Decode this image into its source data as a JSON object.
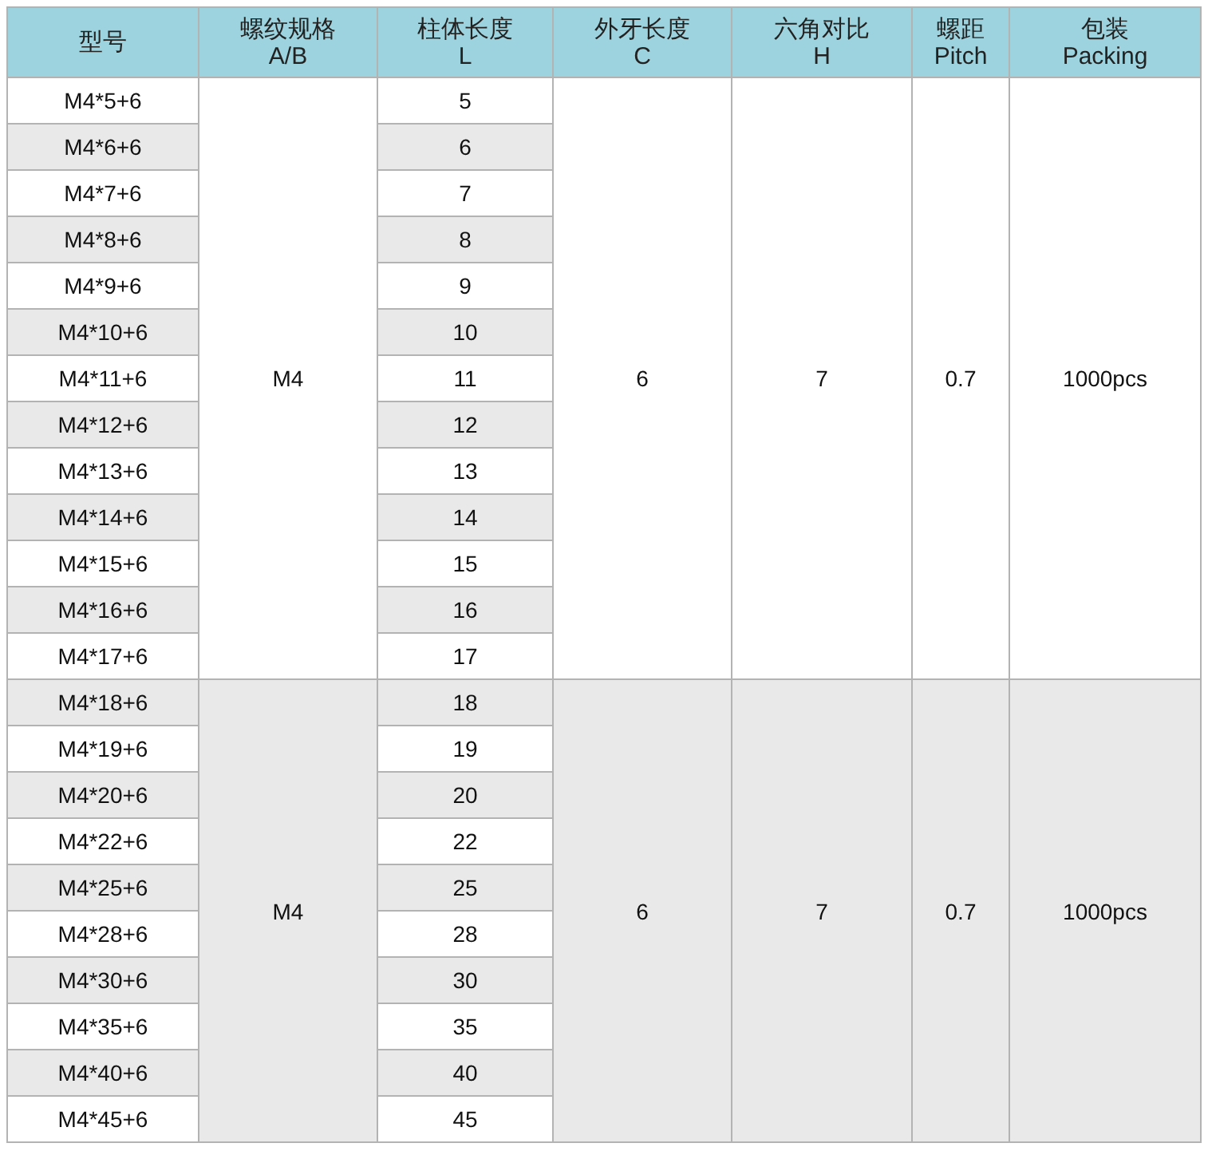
{
  "columns": [
    {
      "line1": "型号"
    },
    {
      "line1": "螺纹规格",
      "line2": "A/B"
    },
    {
      "line1": "柱体长度",
      "line2": "L"
    },
    {
      "line1": "外牙长度",
      "line2": "C"
    },
    {
      "line1": "六角对比",
      "line2": "H"
    },
    {
      "line1": "螺距",
      "line2": "Pitch"
    },
    {
      "line1": "包装",
      "line2": "Packing"
    }
  ],
  "groups": [
    {
      "thread": "M4",
      "c": "6",
      "h": "7",
      "pitch": "0.7",
      "packing": "1000pcs",
      "shaded": false,
      "rows": [
        {
          "model": "M4*5+6",
          "length": "5",
          "shaded": false
        },
        {
          "model": "M4*6+6",
          "length": "6",
          "shaded": true
        },
        {
          "model": "M4*7+6",
          "length": "7",
          "shaded": false
        },
        {
          "model": "M4*8+6",
          "length": "8",
          "shaded": true
        },
        {
          "model": "M4*9+6",
          "length": "9",
          "shaded": false
        },
        {
          "model": "M4*10+6",
          "length": "10",
          "shaded": true
        },
        {
          "model": "M4*11+6",
          "length": "11",
          "shaded": false
        },
        {
          "model": "M4*12+6",
          "length": "12",
          "shaded": true
        },
        {
          "model": "M4*13+6",
          "length": "13",
          "shaded": false
        },
        {
          "model": "M4*14+6",
          "length": "14",
          "shaded": true
        },
        {
          "model": "M4*15+6",
          "length": "15",
          "shaded": false
        },
        {
          "model": "M4*16+6",
          "length": "16",
          "shaded": true
        },
        {
          "model": "M4*17+6",
          "length": "17",
          "shaded": false
        }
      ]
    },
    {
      "thread": "M4",
      "c": "6",
      "h": "7",
      "pitch": "0.7",
      "packing": "1000pcs",
      "shaded": true,
      "rows": [
        {
          "model": "M4*18+6",
          "length": "18",
          "shaded": true
        },
        {
          "model": "M4*19+6",
          "length": "19",
          "shaded": false
        },
        {
          "model": "M4*20+6",
          "length": "20",
          "shaded": true
        },
        {
          "model": "M4*22+6",
          "length": "22",
          "shaded": false
        },
        {
          "model": "M4*25+6",
          "length": "25",
          "shaded": true
        },
        {
          "model": "M4*28+6",
          "length": "28",
          "shaded": false
        },
        {
          "model": "M4*30+6",
          "length": "30",
          "shaded": true
        },
        {
          "model": "M4*35+6",
          "length": "35",
          "shaded": false
        },
        {
          "model": "M4*40+6",
          "length": "40",
          "shaded": true
        },
        {
          "model": "M4*45+6",
          "length": "45",
          "shaded": false
        }
      ]
    }
  ]
}
